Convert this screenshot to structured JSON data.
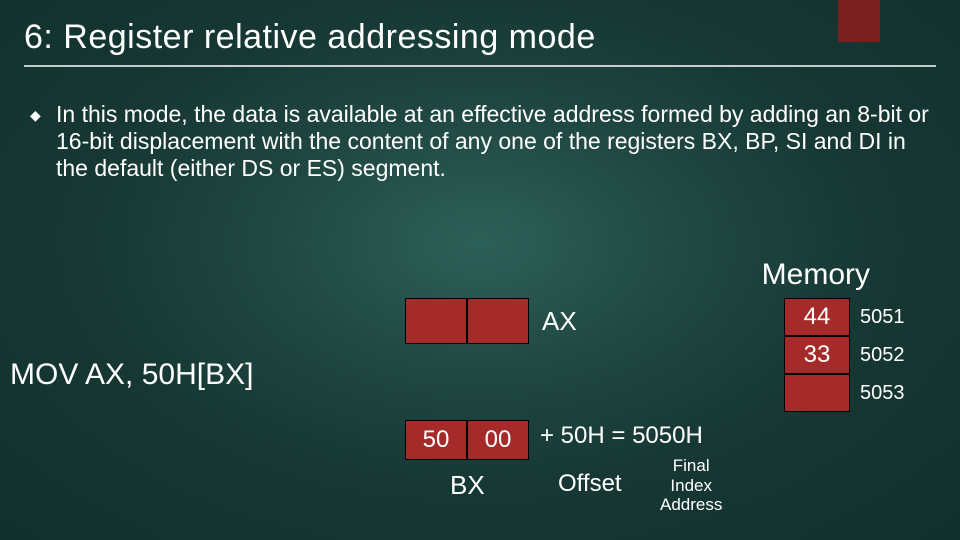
{
  "title": "6: Register relative addressing mode",
  "bullet_glyph": "◆",
  "body": "In this mode, the data is available  at an effective address formed by adding an 8-bit or 16-bit displacement with the content of any one of the registers BX, BP, SI and DI in the default (either DS or ES) segment.",
  "memory_label": "Memory",
  "instruction": "MOV AX, 50H[BX]",
  "ax": {
    "label": "AX",
    "hi": "",
    "lo": ""
  },
  "bx": {
    "label": "BX",
    "hi": "50",
    "lo": "00"
  },
  "calc": "+ 50H = 5050H",
  "offset_label": "Offset",
  "final_label_l1": "Final",
  "final_label_l2": "Index",
  "final_label_l3": "Address",
  "memory": [
    {
      "value": "44",
      "addr": "5051"
    },
    {
      "value": "33",
      "addr": "5052"
    },
    {
      "value": "",
      "addr": "5053"
    }
  ]
}
